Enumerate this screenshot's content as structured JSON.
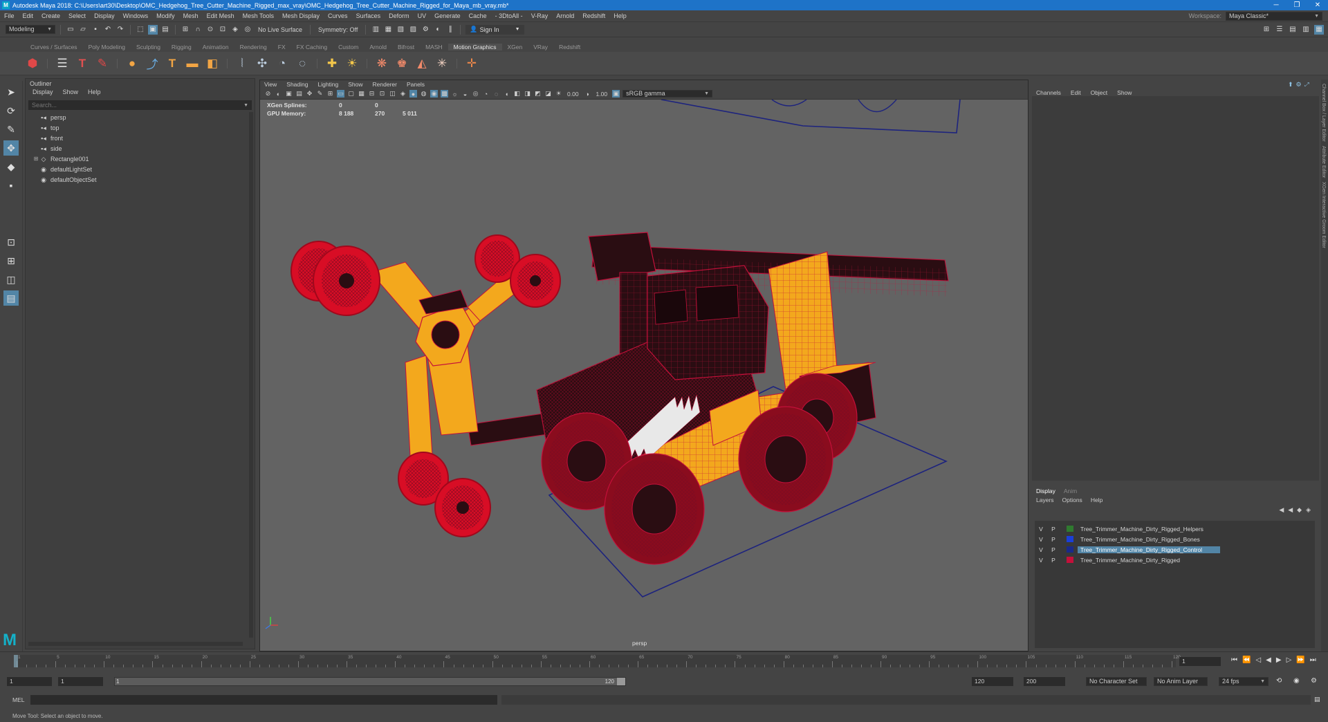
{
  "titlebar": {
    "title": "Autodesk Maya 2018: C:\\Users\\art30\\Desktop\\OMC_Hedgehog_Tree_Cutter_Machine_Rigged_max_vray\\OMC_Hedgehog_Tree_Cutter_Machine_Rigged_for_Maya_mb_vray.mb*",
    "app_icon": "M"
  },
  "menubar": {
    "items": [
      "File",
      "Edit",
      "Create",
      "Select",
      "Display",
      "Windows",
      "Modify",
      "Mesh",
      "Edit Mesh",
      "Mesh Tools",
      "Mesh Display",
      "Curves",
      "Surfaces",
      "Deform",
      "UV",
      "Generate",
      "Cache",
      "- 3DtoAll -",
      "V-Ray",
      "Arnold",
      "Redshift",
      "Help"
    ],
    "workspace_label": "Workspace:",
    "workspace_value": "Maya Classic*"
  },
  "statusline": {
    "mode": "Modeling",
    "live_surface": "No Live Surface",
    "symmetry": "Symmetry: Off",
    "sign_in": "Sign In"
  },
  "shelf": {
    "tabs": [
      "Curves / Surfaces",
      "Poly Modeling",
      "Sculpting",
      "Rigging",
      "Animation",
      "Rendering",
      "FX",
      "FX Caching",
      "Custom",
      "Arnold",
      "Bifrost",
      "MASH",
      "Motion Graphics",
      "XGen",
      "VRay",
      "Redshift"
    ],
    "active_tab": "Motion Graphics"
  },
  "outliner": {
    "title": "Outliner",
    "menu": [
      "Display",
      "Show",
      "Help"
    ],
    "search_placeholder": "Search...",
    "items": [
      {
        "label": "persp",
        "icon": "camera-icon",
        "expandable": false
      },
      {
        "label": "top",
        "icon": "camera-icon",
        "expandable": false
      },
      {
        "label": "front",
        "icon": "camera-icon",
        "expandable": false
      },
      {
        "label": "side",
        "icon": "camera-icon",
        "expandable": false
      },
      {
        "label": "Rectangle001",
        "icon": "transform-icon",
        "expandable": true
      },
      {
        "label": "defaultLightSet",
        "icon": "set-icon",
        "expandable": false
      },
      {
        "label": "defaultObjectSet",
        "icon": "set-icon",
        "expandable": false
      }
    ]
  },
  "viewport": {
    "menu": [
      "View",
      "Shading",
      "Lighting",
      "Show",
      "Renderer",
      "Panels"
    ],
    "exposure": "0.00",
    "gamma": "1.00",
    "color_space": "sRGB gamma",
    "hud": [
      {
        "label": "XGen Splines:",
        "v1": "0",
        "v2": "0",
        "v3": ""
      },
      {
        "label": "GPU Memory:",
        "v1": "8 188",
        "v2": "270",
        "v3": "5 011"
      }
    ],
    "camera_label": "persp",
    "wire_color": "#c4103a",
    "body_color": "#f3a81d",
    "dark_color": "#2a0d12",
    "wheel_color": "#d80d25"
  },
  "channelbox": {
    "menu": [
      "Channels",
      "Edit",
      "Object",
      "Show"
    ]
  },
  "layers": {
    "tabs": [
      "Display",
      "Anim"
    ],
    "menu": [
      "Layers",
      "Options",
      "Help"
    ],
    "rows": [
      {
        "v": "V",
        "p": "P",
        "color": "#2f7a2f",
        "name": "Tree_Trimmer_Machine_Dirty_Rigged_Helpers",
        "selected": false
      },
      {
        "v": "V",
        "p": "P",
        "color": "#1a3fd8",
        "name": "Tree_Trimmer_Machine_Dirty_Rigged_Bones",
        "selected": false
      },
      {
        "v": "V",
        "p": "P",
        "color": "#1a2a8a",
        "name": "Tree_Trimmer_Machine_Dirty_Rigged_Control",
        "selected": true
      },
      {
        "v": "V",
        "p": "P",
        "color": "#c4103a",
        "name": "Tree_Trimmer_Machine_Dirty_Rigged",
        "selected": false
      }
    ]
  },
  "rightstrip": {
    "tabs": [
      "Channel Box / Layer Editor",
      "Attribute Editor",
      "XGen Interactive Groom Editor"
    ]
  },
  "timeslider": {
    "tick_labels": [
      "1",
      "5",
      "10",
      "15",
      "20",
      "25",
      "30",
      "35",
      "40",
      "45",
      "50",
      "55",
      "60",
      "65",
      "70",
      "75",
      "80",
      "85",
      "90",
      "95",
      "100",
      "105",
      "110",
      "115",
      "120"
    ],
    "current_frame": "1"
  },
  "rangebar": {
    "start": "1",
    "range_start": "1",
    "range_handle_left": "1",
    "range_handle_right": "120",
    "range_end": "120",
    "end": "200",
    "character_set": "No Character Set",
    "anim_layer": "No Anim Layer",
    "fps": "24 fps"
  },
  "cmdline": {
    "label": "MEL"
  },
  "helpline": {
    "text": "Move Tool: Select an object to move."
  }
}
